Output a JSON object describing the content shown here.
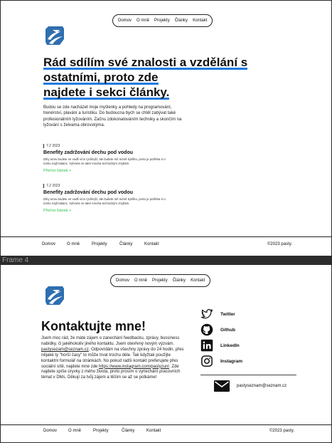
{
  "nav": {
    "items": [
      {
        "label": "Domov"
      },
      {
        "label": "O mně"
      },
      {
        "label": "Projekty"
      },
      {
        "label": "Články"
      },
      {
        "label": "Kontakt"
      }
    ]
  },
  "colors": {
    "accent_blue": "#1f7ae0",
    "link_green": "#2fc24a",
    "logo_blue": "#2f6fb0",
    "frame_bg": "#2c2c2c"
  },
  "articles_page": {
    "hero": {
      "line1": "Rád sdílím své znalosti a vzdělání s",
      "line2": "ostatními, proto zde",
      "line3": "najdete i sekci články."
    },
    "intro": "Budou se zde nacházet moje myšlenky a pohledy na programování, trenérství, plavání a turistiku. Do budoucna bych se chtěl zabývat také profesionálním lyžováním. Začnu zdokonalováním techniky a skončím na lyžování s želvama obrovskýma.",
    "posts": [
      {
        "date": "7.2 2023",
        "title": "Benefity zadržování dechu pod vodou",
        "desc": "Díky tomu budete ve vodě více rychlejší, ale budete mít méně kyslíku, proto je potřeba si v tomto najít balanc. Vyhnete se také mnoha technickým chybám.",
        "more": "Přečíst článek >"
      },
      {
        "date": "7.2 2023",
        "title": "Benefity zadržování dechu pod vodou",
        "desc": "Díky tomu budete ve vodě více rychlejší, ale budete mít méně kyslíku, proto je potřeba si v tomto najít balanc. Vyhnete se také mnoha technickým chybám.",
        "more": "Přečíst článek >"
      }
    ]
  },
  "frame_label": "Frame 4",
  "contact_page": {
    "title": "Kontaktujte mne!",
    "text_a": "Jsem moc rád, že máte zájem o zanechání feedbacku, zprávy, bussiness nabídky, či jakéhokoliv jiného kontaktu. Jsem otevřený novým výzvám. ",
    "email_link": "pastysezam@seznam.cz",
    "text_b": ". Odpovídám na všechny zprávy do 24 hodin, přes nějaké ty \"horší časy\" to může trvat trochu déle. Tak kdyžtak použijte kontaktní formulář na stránkách. No pokud radši kontakt preferujete přes sociální sítě, najdete mne zde ",
    "insta_link": "https://www.instagram.com/pastyzun/",
    "text_c": ". Zde najdete spíše úryvky z mého života, proto prosím o vynechání pracovních témat v DMs. Děkují za tvůj zájem a těším se až se potkáme!",
    "socials": [
      {
        "label": "Twitter",
        "icon": "twitter-icon"
      },
      {
        "label": "Github",
        "icon": "github-icon"
      },
      {
        "label": "LinkedIn",
        "icon": "linkedin-icon"
      },
      {
        "label": "Instagram",
        "icon": "instagram-icon"
      }
    ],
    "email": "pastyseznam@seznam.cz"
  },
  "footer": {
    "links": [
      {
        "label": "Domov"
      },
      {
        "label": "O mně"
      },
      {
        "label": "Projekty"
      },
      {
        "label": "Články"
      },
      {
        "label": "Kontakt"
      }
    ],
    "copyright": "©2023 pasty."
  }
}
